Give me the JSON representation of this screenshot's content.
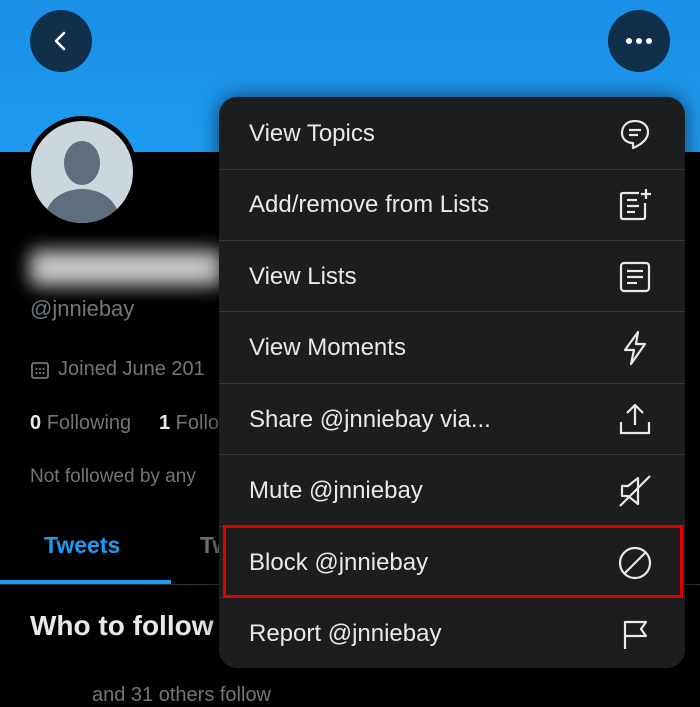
{
  "profile": {
    "handle": "@jnniebay",
    "joined": "Joined June 201",
    "following_count": "0",
    "following_label": "Following",
    "followers_count": "1",
    "followers_label": "Follo",
    "not_followed": "Not followed by any",
    "who_to_follow": "Who to follow",
    "bottom_text": "and 31 others follow"
  },
  "tabs": {
    "active": "Tweets",
    "second": "Tw"
  },
  "menu": {
    "items": [
      {
        "label": "View Topics",
        "icon": "topics-icon"
      },
      {
        "label": "Add/remove from Lists",
        "icon": "list-add-icon"
      },
      {
        "label": "View Lists",
        "icon": "list-icon"
      },
      {
        "label": "View Moments",
        "icon": "lightning-icon"
      },
      {
        "label": "Share @jnniebay via...",
        "icon": "share-icon"
      },
      {
        "label": "Mute @jnniebay",
        "icon": "mute-icon"
      },
      {
        "label": "Block @jnniebay",
        "icon": "block-icon"
      },
      {
        "label": "Report @jnniebay",
        "icon": "flag-icon"
      }
    ],
    "highlighted_item": "Block @jnniebay"
  },
  "colors": {
    "accent": "#1d9bf0",
    "highlight_border": "#e00000",
    "menu_bg": "#1c1d1f"
  }
}
